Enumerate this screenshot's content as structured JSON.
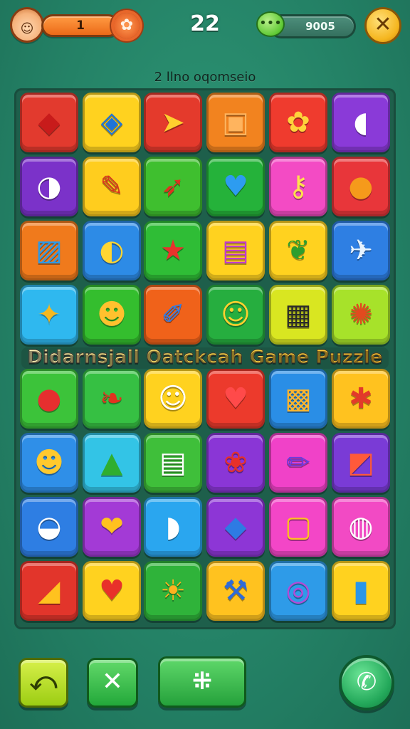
{
  "hud": {
    "level": "1",
    "score": "22",
    "coins": "9005",
    "avatar_glyph": "☺",
    "settings_glyph": "✿",
    "chat_glyph": "•••",
    "close_glyph": "✕"
  },
  "subtitle": "2 llno oqomseio",
  "banner": "Didarnsjall Oatckcah Game Puzzle",
  "board": {
    "rows": [
      [
        {
          "color": "#e23a2e",
          "icon": "diamond-icon",
          "glyph": "◆",
          "fg": "#c81b1b"
        },
        {
          "color": "#ffd21f",
          "icon": "gem-icon",
          "glyph": "◈",
          "fg": "#1f74d8"
        },
        {
          "color": "#e43a2c",
          "icon": "bird-icon",
          "glyph": "➤",
          "fg": "#ffcf2e"
        },
        {
          "color": "#f2831f",
          "icon": "briefcase-icon",
          "glyph": "▣",
          "fg": "#ffb45e"
        },
        {
          "color": "#ef3b2e",
          "icon": "flower-icon",
          "glyph": "✿",
          "fg": "#ffd43b"
        },
        {
          "color": "#8a3ad8",
          "icon": "controller-icon",
          "glyph": "◖",
          "fg": "#ffffff"
        }
      ],
      [
        {
          "color": "#7b32c9",
          "icon": "ball-icon",
          "glyph": "◑",
          "fg": "#ffffff"
        },
        {
          "color": "#ffcd1e",
          "icon": "crayon-icon",
          "glyph": "✎",
          "fg": "#d9331e"
        },
        {
          "color": "#3fbf2f",
          "icon": "arrow-icon",
          "glyph": "➶",
          "fg": "#e0321f"
        },
        {
          "color": "#25b23a",
          "icon": "heart-icon",
          "glyph": "♥",
          "fg": "#2d9cf0"
        },
        {
          "color": "#f34bc4",
          "icon": "key-icon",
          "glyph": "⚷",
          "fg": "#ffe14d"
        },
        {
          "color": "#e8363a",
          "icon": "basketball-icon",
          "glyph": "●",
          "fg": "#f59a1b"
        }
      ],
      [
        {
          "color": "#f07a1c",
          "icon": "picture-icon",
          "glyph": "▨",
          "fg": "#2e9ae8"
        },
        {
          "color": "#2d8be6",
          "icon": "lemon-icon",
          "glyph": "◐",
          "fg": "#ffd633"
        },
        {
          "color": "#2fbd36",
          "icon": "star-icon",
          "glyph": "★",
          "fg": "#e8332c"
        },
        {
          "color": "#ffd21f",
          "icon": "bag-icon",
          "glyph": "▤",
          "fg": "#c23ad0"
        },
        {
          "color": "#ffd21f",
          "icon": "leaf-icon",
          "glyph": "❦",
          "fg": "#2e9e2e"
        },
        {
          "color": "#2e7fe3",
          "icon": "plane-icon",
          "glyph": "✈",
          "fg": "#e6f3ff"
        }
      ],
      [
        {
          "color": "#2fb8ef",
          "icon": "shell-icon",
          "glyph": "✦",
          "fg": "#f5b81f"
        },
        {
          "color": "#34be2e",
          "icon": "cat-face-icon",
          "glyph": "☻",
          "fg": "#ffc12e"
        },
        {
          "color": "#f0621a",
          "icon": "brush-icon",
          "glyph": "✐",
          "fg": "#2e7de8"
        },
        {
          "color": "#26ae3f",
          "icon": "smiley-icon",
          "glyph": "☺",
          "fg": "#ffd12e"
        },
        {
          "color": "#d9e621",
          "icon": "lock-icon",
          "glyph": "▦",
          "fg": "#2a2a2a"
        },
        {
          "color": "#a7e22a",
          "icon": "crab-icon",
          "glyph": "✺",
          "fg": "#e24a1f"
        }
      ],
      [
        {
          "color": "#3cc33a",
          "icon": "balloon-icon",
          "glyph": "●",
          "fg": "#e62f2f"
        },
        {
          "color": "#36c043",
          "icon": "wing-icon",
          "glyph": "❧",
          "fg": "#e2321f"
        },
        {
          "color": "#ffd21f",
          "icon": "dog-face-icon",
          "glyph": "☺",
          "fg": "#ffffff"
        },
        {
          "color": "#ec3a2c",
          "icon": "heart-icon",
          "glyph": "♥",
          "fg": "#ff4a4a"
        },
        {
          "color": "#2a8ee6",
          "icon": "frame-icon",
          "glyph": "▩",
          "fg": "#ffb62e"
        },
        {
          "color": "#ffc21f",
          "icon": "blob-icon",
          "glyph": "✱",
          "fg": "#e23a2a"
        }
      ],
      [
        {
          "color": "#2f8fe8",
          "icon": "smiley-icon",
          "glyph": "☻",
          "fg": "#ffc92e"
        },
        {
          "color": "#33c4e6",
          "icon": "cone-icon",
          "glyph": "▲",
          "fg": "#2fae2f"
        },
        {
          "color": "#3fbf3a",
          "icon": "calendar-icon",
          "glyph": "▤",
          "fg": "#ffffff"
        },
        {
          "color": "#8a36d6",
          "icon": "cherries-icon",
          "glyph": "❀",
          "fg": "#e8302a"
        },
        {
          "color": "#f042c8",
          "icon": "pencil-icon",
          "glyph": "✏",
          "fg": "#6a3be0"
        },
        {
          "color": "#7a3bd6",
          "icon": "kite-icon",
          "glyph": "◩",
          "fg": "#ff5a3a"
        }
      ],
      [
        {
          "color": "#2e7ee3",
          "icon": "ghost-icon",
          "glyph": "◒",
          "fg": "#ffffff"
        },
        {
          "color": "#a33ad6",
          "icon": "tulip-icon",
          "glyph": "❤",
          "fg": "#ffc21f"
        },
        {
          "color": "#2aa6ef",
          "icon": "controller-icon",
          "glyph": "◗",
          "fg": "#ffffff"
        },
        {
          "color": "#8d36d6",
          "icon": "box-icon",
          "glyph": "◆",
          "fg": "#2e7be3"
        },
        {
          "color": "#f346c7",
          "icon": "phone-icon",
          "glyph": "▢",
          "fg": "#ffc21f"
        },
        {
          "color": "#f24ac4",
          "icon": "speech-bubble-icon",
          "glyph": "◍",
          "fg": "#ffffff"
        }
      ],
      [
        {
          "color": "#e2352b",
          "icon": "fish-icon",
          "glyph": "◢",
          "fg": "#ffc21f"
        },
        {
          "color": "#ffd21f",
          "icon": "heart-icon",
          "glyph": "♥",
          "fg": "#e8302a"
        },
        {
          "color": "#2fb33a",
          "icon": "sun-icon",
          "glyph": "☀",
          "fg": "#ffb21f"
        },
        {
          "color": "#ffc21f",
          "icon": "shovel-icon",
          "glyph": "⚒",
          "fg": "#2e6bd8"
        },
        {
          "color": "#2e9be8",
          "icon": "ring-icon",
          "glyph": "◎",
          "fg": "#b54ad8"
        },
        {
          "color": "#ffd21f",
          "icon": "bottle-icon",
          "glyph": "▮",
          "fg": "#2a96e8"
        }
      ]
    ]
  },
  "controls": {
    "back_glyph": "⤺",
    "shuffle_glyph": "✕",
    "hint_glyph": "⁜",
    "call_glyph": "✆"
  }
}
